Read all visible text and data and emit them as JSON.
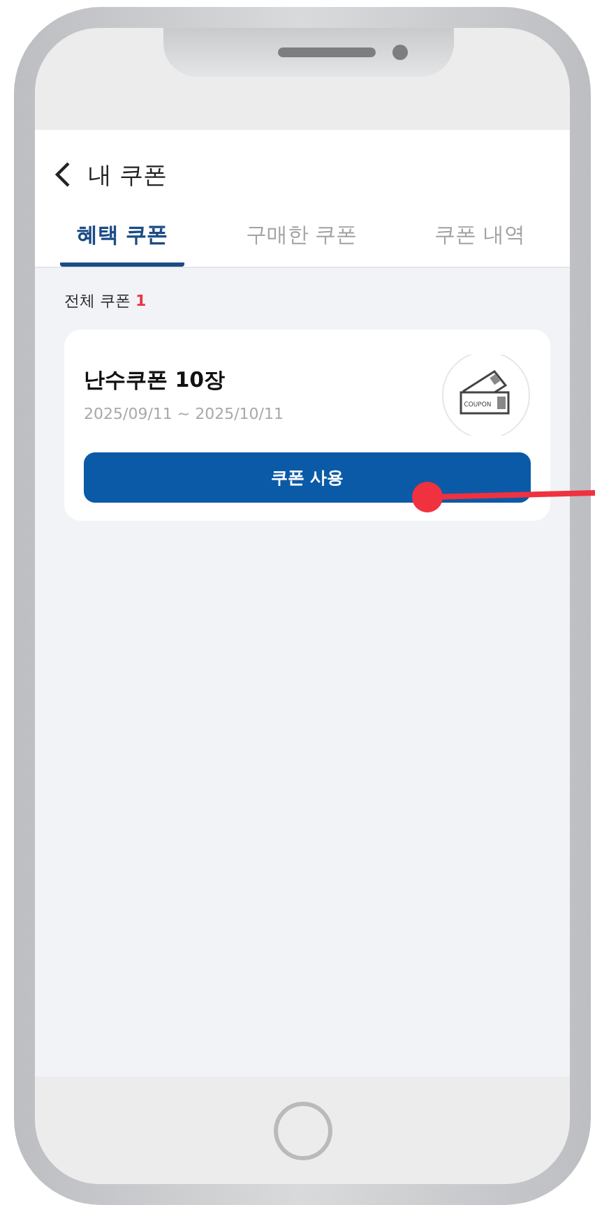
{
  "header": {
    "title": "내 쿠폰"
  },
  "tabs": [
    {
      "label": "혜택 쿠폰",
      "selected": true
    },
    {
      "label": "구매한 쿠폰",
      "selected": false
    },
    {
      "label": "쿠폰 내역",
      "selected": false
    }
  ],
  "summary": {
    "label": "전체 쿠폰",
    "count": "1"
  },
  "coupons": [
    {
      "name": "난수쿠폰 10장",
      "period": "2025/09/11 ~ 2025/10/11",
      "image_label": "COUPON",
      "button": "쿠폰 사용"
    }
  ]
}
